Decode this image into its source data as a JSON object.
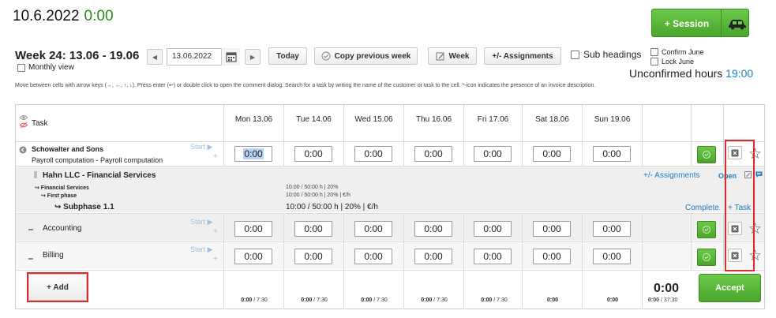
{
  "header": {
    "date": "10.6.2022",
    "clock": "0:00",
    "session_label": "+ Session",
    "week_title": "Week 24: 13.06 - 19.06",
    "monthly_view": "Monthly view",
    "date_input": "13.06.2022",
    "today": "Today",
    "copy_previous_week": "Copy previous week",
    "week": "Week",
    "assignments": "+/- Assignments",
    "sub_headings": "Sub headings",
    "confirm_june": "Confirm June",
    "lock_june": "Lock June",
    "unconfirmed_label": "Unconfirmed hours",
    "unconfirmed_value": "19:00",
    "help_text": "Move between cells with arrow keys (→, ←, ↑, ↓). Press enter (↩) or double click to open the comment dialog. Search for a task by writing the name of the customer or task to the cell. *-icon indicates the presence of an invoice description."
  },
  "table": {
    "task_header": "Task",
    "days": [
      "Mon 13.06",
      "Tue 14.06",
      "Wed 15.06",
      "Thu 16.06",
      "Fri 17.06",
      "Sat 18.06",
      "Sun 19.06"
    ],
    "start_label": "Start ▶",
    "plus_label": "+",
    "rows": [
      {
        "title": "Schowalter and Sons",
        "subtitle": "Payroll computation - Payroll computation",
        "values": [
          "0:00",
          "0:00",
          "0:00",
          "0:00",
          "0:00",
          "0:00",
          "0:00"
        ]
      },
      {
        "title": "Accounting",
        "values": [
          "0:00",
          "0:00",
          "0:00",
          "0:00",
          "0:00",
          "0:00",
          "0:00"
        ]
      },
      {
        "title": "Billing",
        "values": [
          "0:00",
          "0:00",
          "0:00",
          "0:00",
          "0:00",
          "0:00",
          "0:00"
        ]
      }
    ],
    "group": {
      "name": "Hahn LLC - Financial Services",
      "service": "↪ Financial Services",
      "phase": "↪ First phase",
      "subphase": "↪ Subphase 1.1",
      "budget_small_1": "10:00 / 50:00 h | 20%",
      "budget_small_2": "10:00 / 50:00 h | 20% | €/h",
      "budget_main": "10:00 / 50:00 h | 20% | €/h",
      "assignments_link": "+/- Assignments",
      "open_label": "Open",
      "complete_link": "Complete",
      "add_task_link": "+ Task"
    },
    "footer": {
      "add_label": "+ Add",
      "day_totals_done": [
        "0:00",
        "0:00",
        "0:00",
        "0:00",
        "0:00",
        "0:00",
        "0:00"
      ],
      "day_totals_target": [
        "/ 7:30",
        "/ 7:30",
        "/ 7:30",
        "/ 7:30",
        "/ 7:30",
        "",
        ""
      ],
      "week_total": "0:00",
      "week_total_done": "0:00",
      "week_total_target": "/ 37:30",
      "accept_label": "Accept"
    }
  }
}
